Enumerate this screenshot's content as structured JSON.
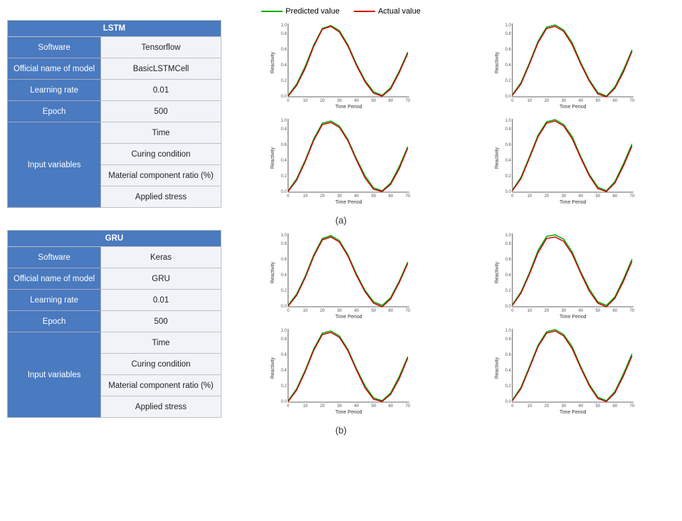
{
  "legend": {
    "predicted_label": "Predicted value",
    "actual_label": "Actual value",
    "predicted_color": "#00aa00",
    "actual_color": "#cc0000"
  },
  "section_a": {
    "label": "(a)",
    "table": {
      "header": "LSTM",
      "rows": [
        {
          "label": "Software",
          "value": "Tensorflow"
        },
        {
          "label": "Official name of model",
          "value": "BasicLSTMCell"
        },
        {
          "label": "Learning rate",
          "value": "0.01"
        },
        {
          "label": "Epoch",
          "value": "500"
        },
        {
          "label": "Input variables",
          "values": [
            "Time",
            "Curing condition",
            "Material component ratio (%)",
            "Applied stress"
          ]
        }
      ]
    }
  },
  "section_b": {
    "label": "(b)",
    "table": {
      "header": "GRU",
      "rows": [
        {
          "label": "Software",
          "value": "Keras"
        },
        {
          "label": "Official name of model",
          "value": "GRU"
        },
        {
          "label": "Learning rate",
          "value": "0.01"
        },
        {
          "label": "Epoch",
          "value": "500"
        },
        {
          "label": "Input variables",
          "values": [
            "Time",
            "Curing condition",
            "Material component ratio (%)",
            "Applied stress"
          ]
        }
      ]
    }
  },
  "chart": {
    "x_label": "Time Period",
    "y_label": "Reactivity",
    "x_ticks": [
      0,
      10,
      20,
      30,
      40,
      50,
      60,
      70
    ],
    "y_range": [
      0.0,
      1.0
    ]
  }
}
